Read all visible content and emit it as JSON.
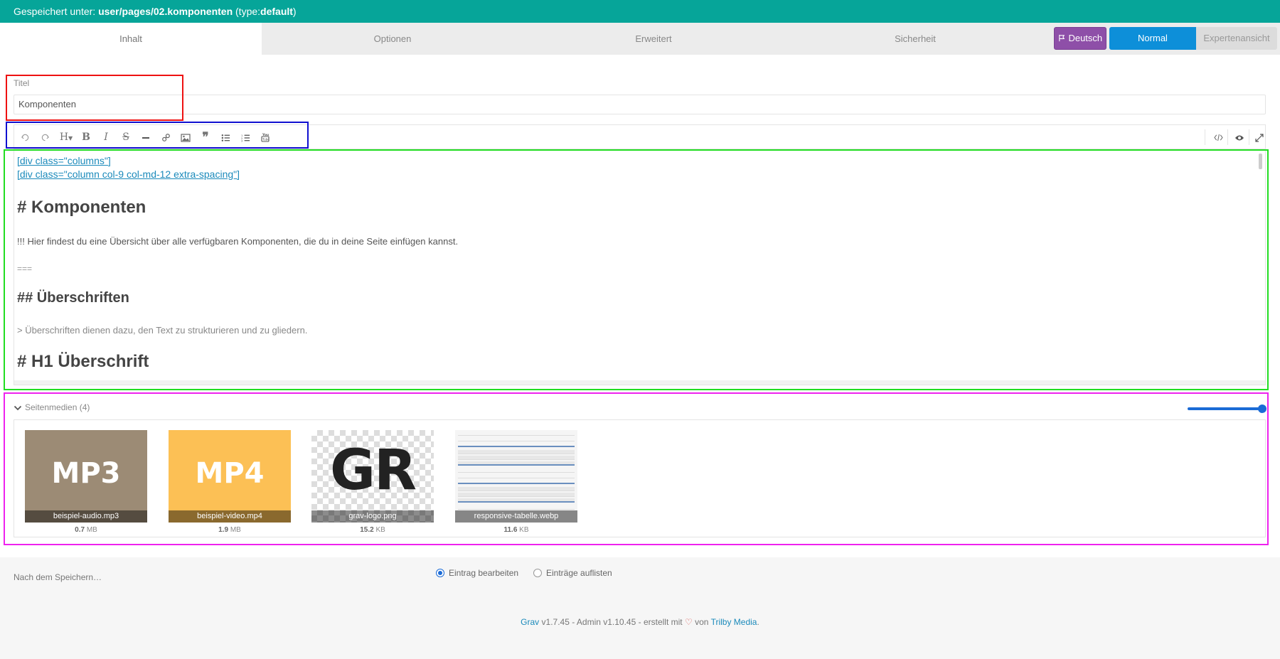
{
  "notice": {
    "prefix": "Gespeichert unter:",
    "path": "user/pages/02.komponenten",
    "type_prefix": "(type:",
    "type_value": "default",
    "type_suffix": ")"
  },
  "tabs": [
    {
      "label": "Inhalt",
      "active": true
    },
    {
      "label": "Optionen",
      "active": false
    },
    {
      "label": "Erweitert",
      "active": false
    },
    {
      "label": "Sicherheit",
      "active": false
    }
  ],
  "language_button": {
    "label": "Deutsch",
    "color": "#8e4fa8"
  },
  "mode": {
    "normal_label": "Normal",
    "expert_label": "Expertenansicht",
    "accent": "#0d8fd9"
  },
  "title_field": {
    "label": "Titel",
    "value": "Komponenten"
  },
  "toolbar": {
    "left_icons": [
      "undo-icon",
      "redo-icon",
      "heading-icon",
      "bold-icon",
      "italic-icon",
      "strikethrough-icon",
      "horizontal-rule-icon",
      "link-icon",
      "image-icon",
      "quote-icon",
      "unordered-list-icon",
      "ordered-list-icon",
      "youtube-icon"
    ],
    "right_icons": [
      "code-icon",
      "preview-eye-icon",
      "fullscreen-icon"
    ]
  },
  "editor": {
    "lines": [
      "[div class=\"columns\"]",
      "[div class=\"column col-9 col-md-12 extra-spacing\"]",
      "# Komponenten",
      "!!! Hier findest du eine Übersicht über alle verfügbaren Komponenten, die du in deine Seite einfügen kannst.",
      "===",
      "## Überschriften",
      "> Überschriften dienen dazu, den Text zu strukturieren und zu gliedern.",
      "# H1 Überschrift"
    ]
  },
  "media": {
    "header": "Seitenmedien (4)",
    "files": [
      {
        "thumb_text": "MP3",
        "name": "beispiel-audio.mp3",
        "size_value": "0.7",
        "size_unit": "MB",
        "color": "#9c8b75"
      },
      {
        "thumb_text": "MP4",
        "name": "beispiel-video.mp4",
        "size_value": "1.9",
        "size_unit": "MB",
        "color": "#fcc055"
      },
      {
        "thumb_text": "GR",
        "name": "grav-logo.png",
        "size_value": "15.2",
        "size_unit": "KB",
        "color": "#222222"
      },
      {
        "thumb_text": "",
        "name": "responsive-tabelle.webp",
        "size_value": "11.6",
        "size_unit": "KB",
        "color": "#f5f5f5"
      }
    ]
  },
  "after_save": {
    "label": "Nach dem Speichern…",
    "options": [
      {
        "label": "Eintrag bearbeiten",
        "checked": true
      },
      {
        "label": "Einträge auflisten",
        "checked": false
      }
    ]
  },
  "footer": {
    "grav_link": "Grav",
    "version_text": "v1.7.45 - Admin v1.10.45 - erstellt mit",
    "heart": "♡",
    "by_text": "von",
    "trilby_link": "Trilby Media",
    "end": "."
  }
}
